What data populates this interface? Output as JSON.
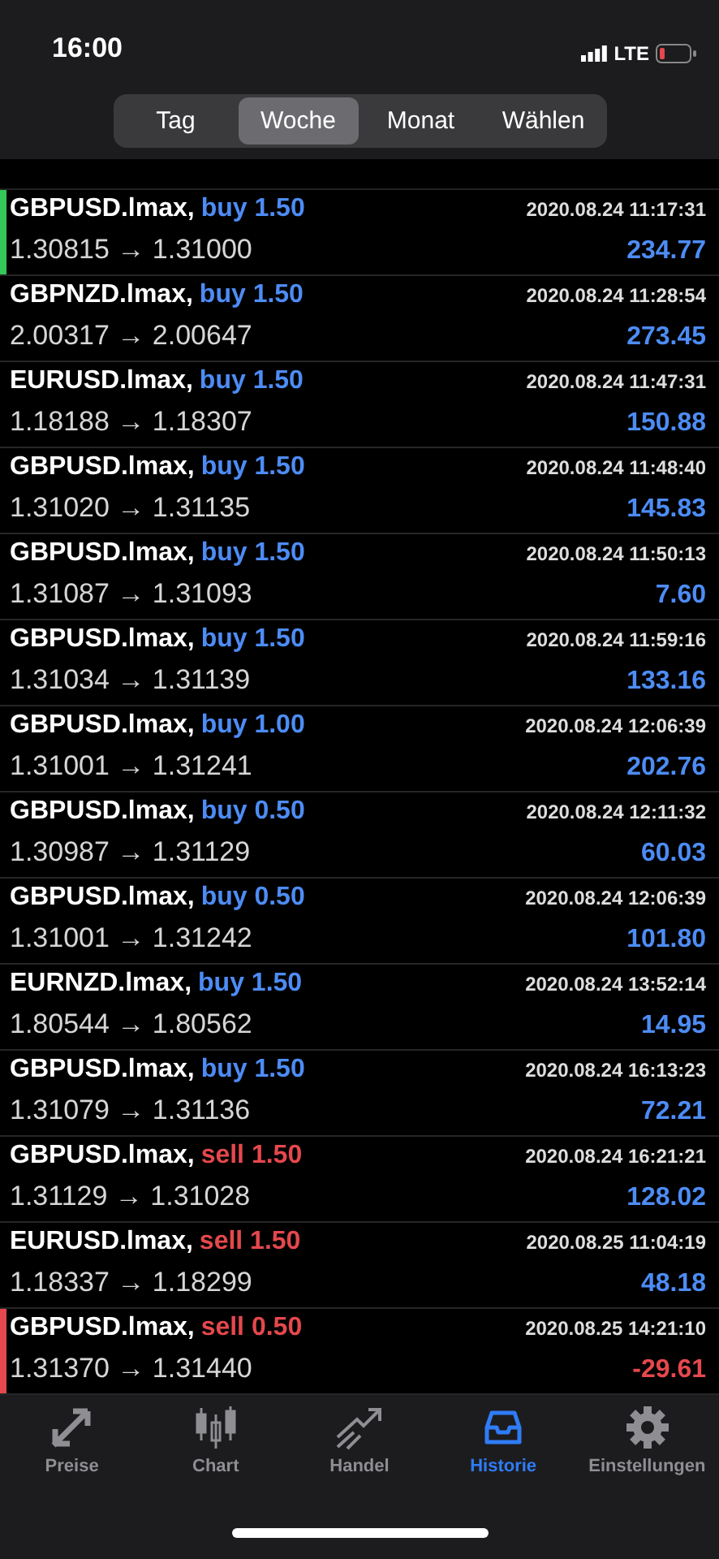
{
  "status_bar": {
    "time": "16:00",
    "network": "LTE"
  },
  "period_tabs": [
    {
      "label": "Tag",
      "selected": false
    },
    {
      "label": "Woche",
      "selected": true
    },
    {
      "label": "Monat",
      "selected": false
    },
    {
      "label": "Wählen",
      "selected": false
    }
  ],
  "trades": [
    {
      "symbol": "GBPUSD.lmax,",
      "kind": "buy",
      "order": "buy 1.50",
      "time": "2020.08.24 11:17:31",
      "prices": "1.30815 → 1.31000",
      "profit": "234.77",
      "loss": false,
      "color": "#34c759"
    },
    {
      "symbol": "GBPNZD.lmax,",
      "kind": "buy",
      "order": "buy 1.50",
      "time": "2020.08.24 11:28:54",
      "prices": "2.00317 → 2.00647",
      "profit": "273.45",
      "loss": false
    },
    {
      "symbol": "EURUSD.lmax,",
      "kind": "buy",
      "order": "buy 1.50",
      "time": "2020.08.24 11:47:31",
      "prices": "1.18188 → 1.18307",
      "profit": "150.88",
      "loss": false
    },
    {
      "symbol": "GBPUSD.lmax,",
      "kind": "buy",
      "order": "buy 1.50",
      "time": "2020.08.24 11:48:40",
      "prices": "1.31020 → 1.31135",
      "profit": "145.83",
      "loss": false
    },
    {
      "symbol": "GBPUSD.lmax,",
      "kind": "buy",
      "order": "buy 1.50",
      "time": "2020.08.24 11:50:13",
      "prices": "1.31087 → 1.31093",
      "profit": "7.60",
      "loss": false
    },
    {
      "symbol": "GBPUSD.lmax,",
      "kind": "buy",
      "order": "buy 1.50",
      "time": "2020.08.24 11:59:16",
      "prices": "1.31034 → 1.31139",
      "profit": "133.16",
      "loss": false
    },
    {
      "symbol": "GBPUSD.lmax,",
      "kind": "buy",
      "order": "buy 1.00",
      "time": "2020.08.24 12:06:39",
      "prices": "1.31001 → 1.31241",
      "profit": "202.76",
      "loss": false
    },
    {
      "symbol": "GBPUSD.lmax,",
      "kind": "buy",
      "order": "buy 0.50",
      "time": "2020.08.24 12:11:32",
      "prices": "1.30987 → 1.31129",
      "profit": "60.03",
      "loss": false
    },
    {
      "symbol": "GBPUSD.lmax,",
      "kind": "buy",
      "order": "buy 0.50",
      "time": "2020.08.24 12:06:39",
      "prices": "1.31001 → 1.31242",
      "profit": "101.80",
      "loss": false
    },
    {
      "symbol": "EURNZD.lmax,",
      "kind": "buy",
      "order": "buy 1.50",
      "time": "2020.08.24 13:52:14",
      "prices": "1.80544 → 1.80562",
      "profit": "14.95",
      "loss": false
    },
    {
      "symbol": "GBPUSD.lmax,",
      "kind": "buy",
      "order": "buy 1.50",
      "time": "2020.08.24 16:13:23",
      "prices": "1.31079 → 1.31136",
      "profit": "72.21",
      "loss": false
    },
    {
      "symbol": "GBPUSD.lmax,",
      "kind": "sell",
      "order": "sell 1.50",
      "time": "2020.08.24 16:21:21",
      "prices": "1.31129 → 1.31028",
      "profit": "128.02",
      "loss": false
    },
    {
      "symbol": "EURUSD.lmax,",
      "kind": "sell",
      "order": "sell 1.50",
      "time": "2020.08.25 11:04:19",
      "prices": "1.18337 → 1.18299",
      "profit": "48.18",
      "loss": false
    },
    {
      "symbol": "GBPUSD.lmax,",
      "kind": "sell",
      "order": "sell 0.50",
      "time": "2020.08.25 14:21:10",
      "prices": "1.31370 → 1.31440",
      "profit": "-29.61",
      "loss": true,
      "color": "#e5484d"
    }
  ],
  "bottom_tabs": [
    {
      "label": "Preise",
      "kind": "prices",
      "selected": false
    },
    {
      "label": "Chart",
      "kind": "chart",
      "selected": false
    },
    {
      "label": "Handel",
      "kind": "trade",
      "selected": false
    },
    {
      "label": "Historie",
      "kind": "history",
      "selected": true
    },
    {
      "label": "Einstellungen",
      "kind": "settings",
      "selected": false
    }
  ]
}
